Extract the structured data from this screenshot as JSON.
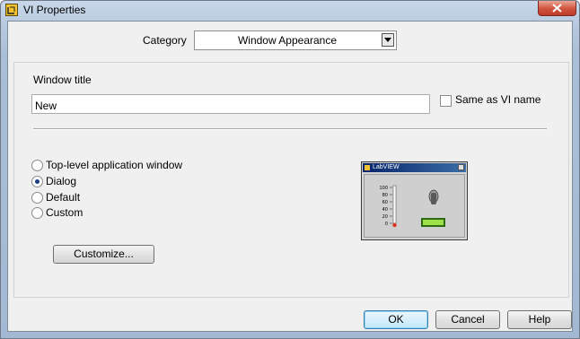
{
  "window": {
    "title": "VI Properties"
  },
  "category": {
    "label": "Category",
    "value": "Window Appearance"
  },
  "window_title": {
    "label": "Window title",
    "value": "New"
  },
  "same_as_vi_name": {
    "label": "Same as VI name",
    "checked": false
  },
  "appearance_options": [
    {
      "label": "Top-level application window",
      "selected": false
    },
    {
      "label": "Dialog",
      "selected": true
    },
    {
      "label": "Default",
      "selected": false
    },
    {
      "label": "Custom",
      "selected": false
    }
  ],
  "customize_button": "Customize...",
  "preview": {
    "title": "LabVIEW",
    "scale_labels": [
      "100",
      "80",
      "60",
      "40",
      "20",
      "0"
    ]
  },
  "buttons": {
    "ok": "OK",
    "cancel": "Cancel",
    "help": "Help"
  }
}
